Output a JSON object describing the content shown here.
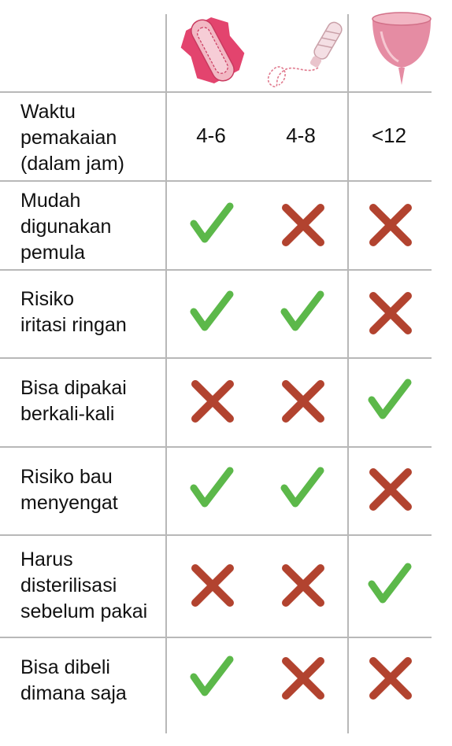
{
  "columns": [
    {
      "name": "Pembalut",
      "icon": "sanitary-pad-icon"
    },
    {
      "name": "Tampon",
      "icon": "tampon-icon"
    },
    {
      "name": "Menstrual cup",
      "icon": "menstrual-cup-icon"
    }
  ],
  "rows": [
    {
      "label": "Waktu\npemakaian\n(dalam jam)",
      "values": [
        "4-6",
        "4-8",
        "<12"
      ]
    },
    {
      "label": "Mudah\ndigunakan\npemula",
      "marks": [
        "check",
        "cross",
        "cross"
      ]
    },
    {
      "label": "Risiko\niritasi ringan",
      "marks": [
        "check",
        "check",
        "cross"
      ]
    },
    {
      "label": "Bisa dipakai\nberkali-kali",
      "marks": [
        "cross",
        "cross",
        "check"
      ]
    },
    {
      "label": "Risiko bau\nmenyengat",
      "marks": [
        "check",
        "check",
        "cross"
      ]
    },
    {
      "label": "Harus\ndisterilisasi\nsebelum pakai",
      "marks": [
        "cross",
        "cross",
        "check"
      ]
    },
    {
      "label": "Bisa dibeli\ndimana saja",
      "marks": [
        "check",
        "cross",
        "cross"
      ]
    }
  ],
  "colors": {
    "check": "#5cb84a",
    "cross": "#b2432f",
    "grid": "#b8b8b8"
  }
}
